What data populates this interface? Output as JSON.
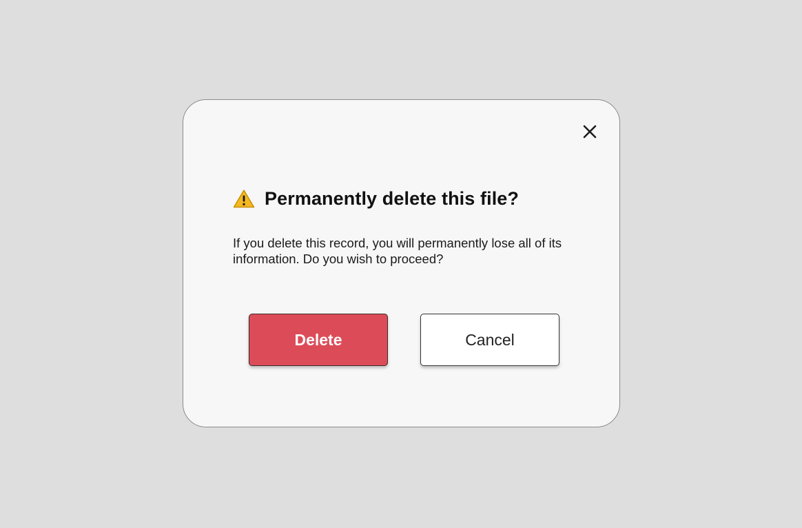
{
  "dialog": {
    "title": "Permanently delete this file?",
    "message": "If you delete this record, you will permanently lose all of its information. Do you wish to proceed?",
    "title_icon": "warning-icon",
    "close_icon": "close-icon",
    "delete_label": "Delete",
    "cancel_label": "Cancel"
  },
  "colors": {
    "backdrop": "#dedede",
    "dialog_background": "#f7f7f7",
    "delete_button": "#dc4c58",
    "warning_icon": "#f5b81e"
  }
}
